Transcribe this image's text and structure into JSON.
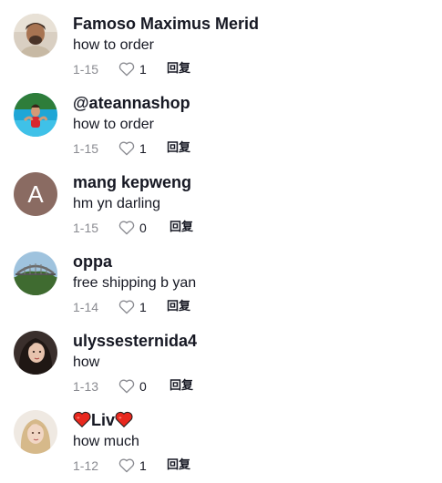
{
  "comments": [
    {
      "username": "Famoso Maximus Merid",
      "text": "how to order",
      "date": "1-15",
      "likes": "1",
      "reply_label": "回复",
      "avatar": "photo-man-icon"
    },
    {
      "username": "@ateannashop",
      "text": "how to order",
      "date": "1-15",
      "likes": "1",
      "reply_label": "回复",
      "avatar": "photo-pool-icon"
    },
    {
      "username": "mang kepweng",
      "text": "hm yn darling",
      "date": "1-15",
      "likes": "0",
      "reply_label": "回复",
      "avatar_letter": "A"
    },
    {
      "username": "oppa",
      "text": "free shipping b yan",
      "date": "1-14",
      "likes": "1",
      "reply_label": "回复",
      "avatar": "photo-bridge-icon"
    },
    {
      "username": "ulyssesternida4",
      "text": "how",
      "date": "1-13",
      "likes": "0",
      "reply_label": "回复",
      "avatar": "photo-woman-icon"
    },
    {
      "username_core": "Liv",
      "text": "how much",
      "date": "1-12",
      "likes": "1",
      "reply_label": "回复",
      "avatar": "photo-blonde-icon"
    }
  ],
  "colors": {
    "text": "#161823",
    "muted": "#8a8b91",
    "heart_emoji": "#e8281e",
    "letter_avatar_bg": "#8a6b62"
  }
}
